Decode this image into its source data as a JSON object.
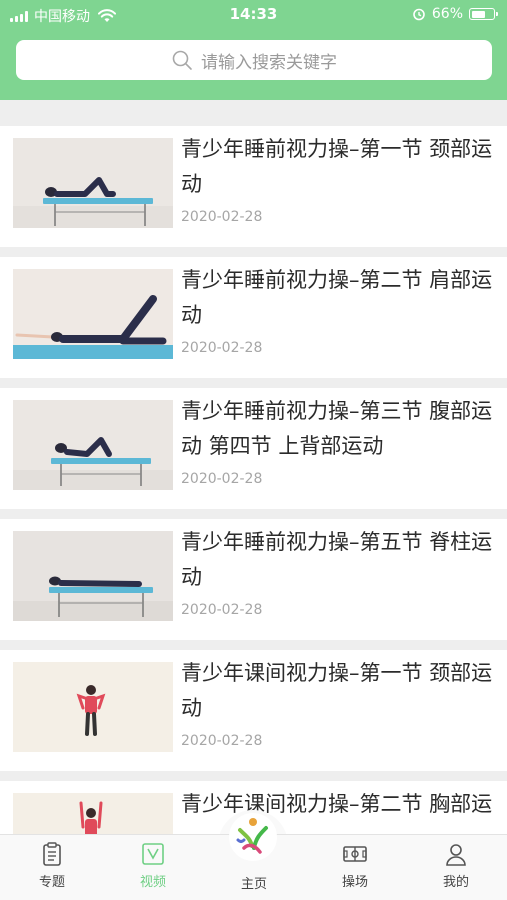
{
  "status_bar": {
    "carrier": "中国移动",
    "time": "14:33",
    "battery": "66%",
    "battery_level": 0.66
  },
  "search": {
    "placeholder": "请输入搜索关键字"
  },
  "videos": [
    {
      "title": "青少年睡前视力操–第一节 颈部运动",
      "date": "2020-02-28"
    },
    {
      "title": "青少年睡前视力操–第二节 肩部运动",
      "date": "2020-02-28"
    },
    {
      "title": "青少年睡前视力操–第三节 腹部运动 第四节 上背部运动",
      "date": "2020-02-28"
    },
    {
      "title": "青少年睡前视力操–第五节 脊柱运动",
      "date": "2020-02-28"
    },
    {
      "title": "青少年课间视力操–第一节 颈部运动",
      "date": "2020-02-28"
    },
    {
      "title": "青少年课间视力操–第二节 胸部运",
      "date": ""
    }
  ],
  "tabs": {
    "topic": "专题",
    "video": "视频",
    "home": "主页",
    "playground": "操场",
    "mine": "我的"
  },
  "colors": {
    "header": "#7fd591",
    "active_tab": "#6fcf84"
  }
}
